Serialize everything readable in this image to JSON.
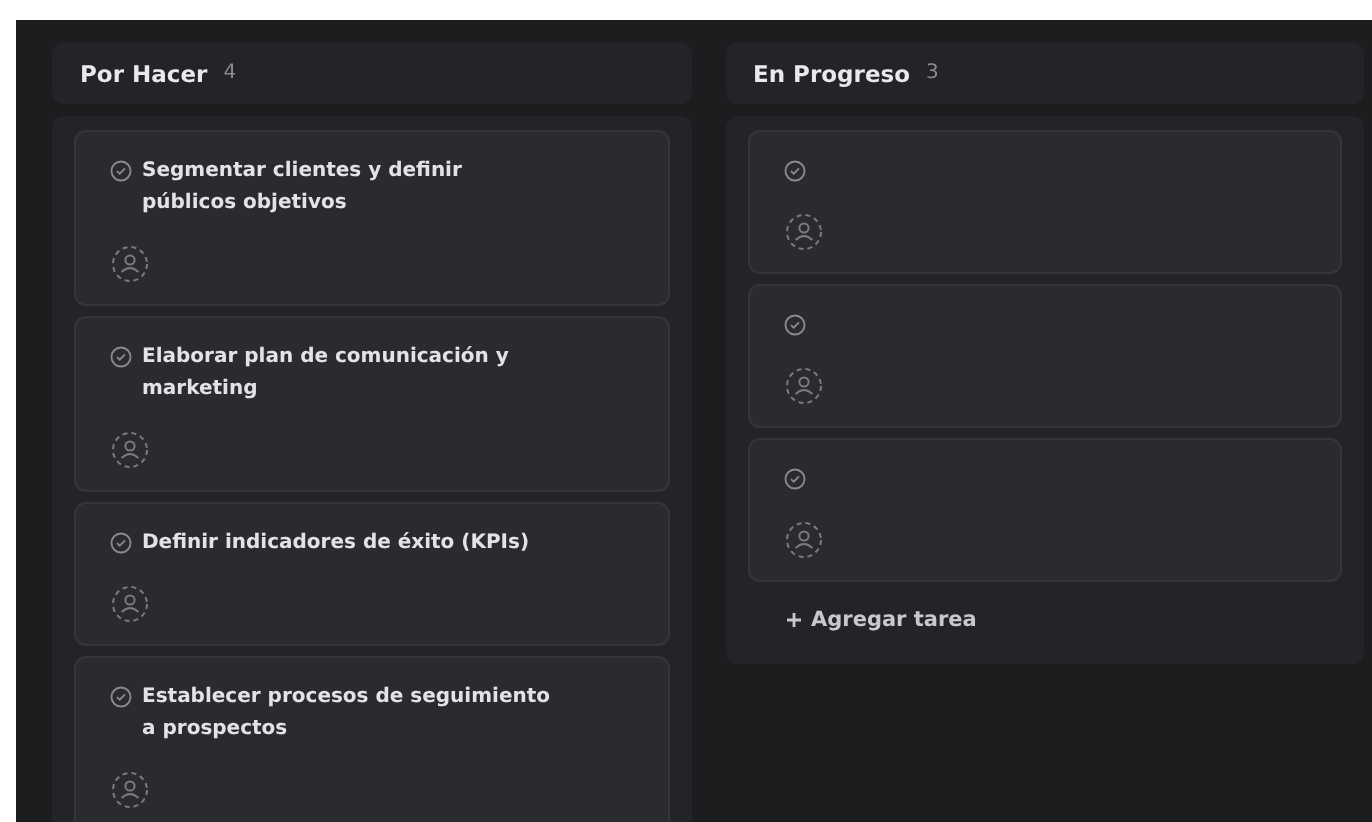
{
  "columns": [
    {
      "title": "Por Hacer",
      "count": "4",
      "tasks": [
        {
          "kind": "titled",
          "title": "Segmentar clientes y definir públicos objetivos"
        },
        {
          "kind": "titled",
          "title": "Elaborar plan de comunicación y marketing"
        },
        {
          "kind": "titled",
          "title": "Definir indicadores de éxito (KPIs)"
        },
        {
          "kind": "titled",
          "title": "Establecer procesos de seguimiento a prospectos"
        }
      ]
    },
    {
      "title": "En Progreso",
      "count": "3",
      "tasks": [
        {
          "kind": "blank"
        },
        {
          "kind": "blank"
        },
        {
          "kind": "blank"
        }
      ],
      "add_label": "Agregar tarea"
    }
  ]
}
